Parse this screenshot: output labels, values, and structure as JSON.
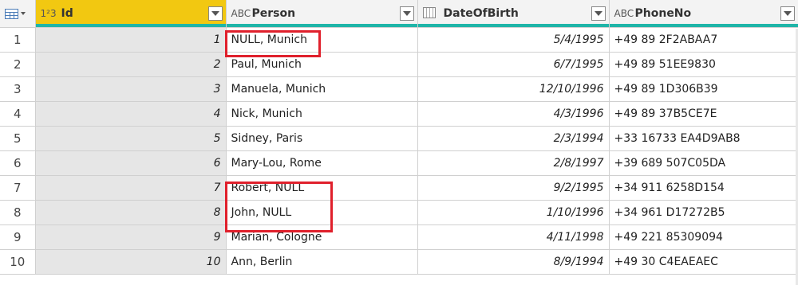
{
  "columns": {
    "id": {
      "label": "Id",
      "type_icon": "1²3"
    },
    "person": {
      "label": "Person",
      "type_icon": "ABC"
    },
    "dob": {
      "label": "DateOfBirth",
      "type_icon": "calendar"
    },
    "phone": {
      "label": "PhoneNo",
      "type_icon": "ABC"
    }
  },
  "rows": [
    {
      "num": "1",
      "id": "1",
      "person": "NULL, Munich",
      "dob": "5/4/1995",
      "phone": "+49 89 2F2ABAA7"
    },
    {
      "num": "2",
      "id": "2",
      "person": "Paul, Munich",
      "dob": "6/7/1995",
      "phone": "+49 89 51EE9830"
    },
    {
      "num": "3",
      "id": "3",
      "person": "Manuela, Munich",
      "dob": "12/10/1996",
      "phone": "+49 89 1D306B39"
    },
    {
      "num": "4",
      "id": "4",
      "person": "Nick, Munich",
      "dob": "4/3/1996",
      "phone": "+49 89 37B5CE7E"
    },
    {
      "num": "5",
      "id": "5",
      "person": "Sidney, Paris",
      "dob": "2/3/1994",
      "phone": "+33 16733 EA4D9AB8"
    },
    {
      "num": "6",
      "id": "6",
      "person": "Mary-Lou, Rome",
      "dob": "2/8/1997",
      "phone": "+39 689 507C05DA"
    },
    {
      "num": "7",
      "id": "7",
      "person": "Robert, NULL",
      "dob": "9/2/1995",
      "phone": "+34 911 6258D154"
    },
    {
      "num": "8",
      "id": "8",
      "person": "John, NULL",
      "dob": "1/10/1996",
      "phone": "+34 961 D17272B5"
    },
    {
      "num": "9",
      "id": "9",
      "person": "Marian, Cologne",
      "dob": "4/11/1998",
      "phone": "+49 221 85309094"
    },
    {
      "num": "10",
      "id": "10",
      "person": "Ann, Berlin",
      "dob": "8/9/1994",
      "phone": "+49 30 C4EAEAEC"
    }
  ],
  "colors": {
    "selected_header": "#f2c811",
    "quality_bar": "#1fb5a8",
    "highlight": "#e0202c"
  }
}
